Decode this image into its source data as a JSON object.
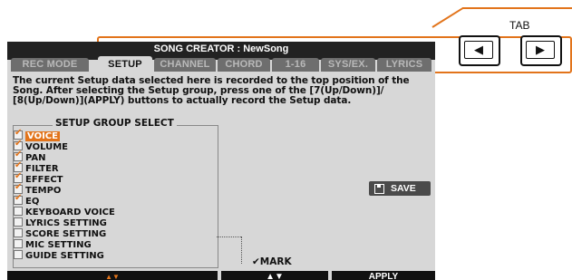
{
  "title": "SONG CREATOR : NewSong",
  "tabs": [
    "REC MODE",
    "SETUP",
    "CHANNEL",
    "CHORD",
    "1-16",
    "SYS/EX.",
    "LYRICS"
  ],
  "active_tab": "SETUP",
  "description": "The current Setup data selected here is recorded to the top position of the\nSong. After selecting the Setup group, press one of the [7(Up/Down)]/\n[8(Up/Down)](APPLY) buttons to actually record the Setup data.",
  "group_title": "SETUP GROUP SELECT",
  "items": [
    {
      "label": "VOICE",
      "checked": true
    },
    {
      "label": "VOLUME",
      "checked": true
    },
    {
      "label": "PAN",
      "checked": true
    },
    {
      "label": "FILTER",
      "checked": true
    },
    {
      "label": "EFFECT",
      "checked": true
    },
    {
      "label": "TEMPO",
      "checked": true
    },
    {
      "label": "EQ",
      "checked": true
    },
    {
      "label": "KEYBOARD VOICE",
      "checked": false
    },
    {
      "label": "LYRICS SETTING",
      "checked": false
    },
    {
      "label": "SCORE SETTING",
      "checked": false
    },
    {
      "label": "MIC SETTING",
      "checked": false
    },
    {
      "label": "GUIDE SETTING",
      "checked": false
    }
  ],
  "save_label": "SAVE",
  "mark_label": "✔MARK",
  "bottom": {
    "left_arrows": "▲▼",
    "mid_arrows": "▲▼",
    "apply": "APPLY"
  },
  "tab_callout": {
    "label": "TAB",
    "left": "◀",
    "right": "▶"
  },
  "colors": {
    "accent": "#e2741b",
    "screen_bg": "#d7d7d7",
    "titlebar": "#222222"
  }
}
